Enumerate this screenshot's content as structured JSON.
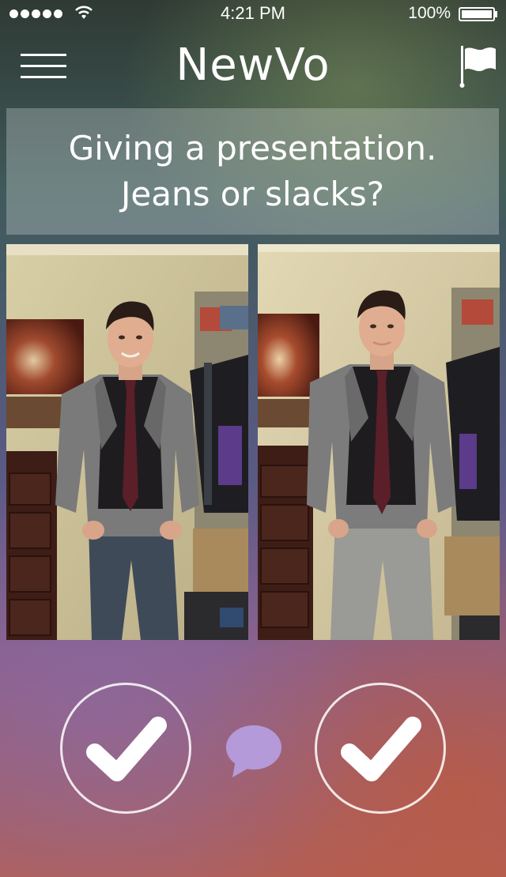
{
  "status_bar": {
    "time": "4:21 PM",
    "battery_percent": "100%",
    "signal_icon": "signal-dots-icon",
    "wifi_icon": "wifi-icon",
    "battery_icon": "battery-full-icon"
  },
  "nav": {
    "title": "NewVo",
    "menu_icon": "hamburger-menu-icon",
    "flag_icon": "flag-icon"
  },
  "question": {
    "line1": "Giving a presentation.",
    "line2": "Jeans or slacks?"
  },
  "options": [
    {
      "photo": "man-in-blazer-and-jeans",
      "vote_icon": "checkmark-icon"
    },
    {
      "photo": "man-in-blazer-and-slacks",
      "vote_icon": "checkmark-icon"
    }
  ],
  "comment_icon": "speech-bubble-icon",
  "colors": {
    "text": "#ffffff",
    "comment_bubble": "#b49ad8"
  }
}
